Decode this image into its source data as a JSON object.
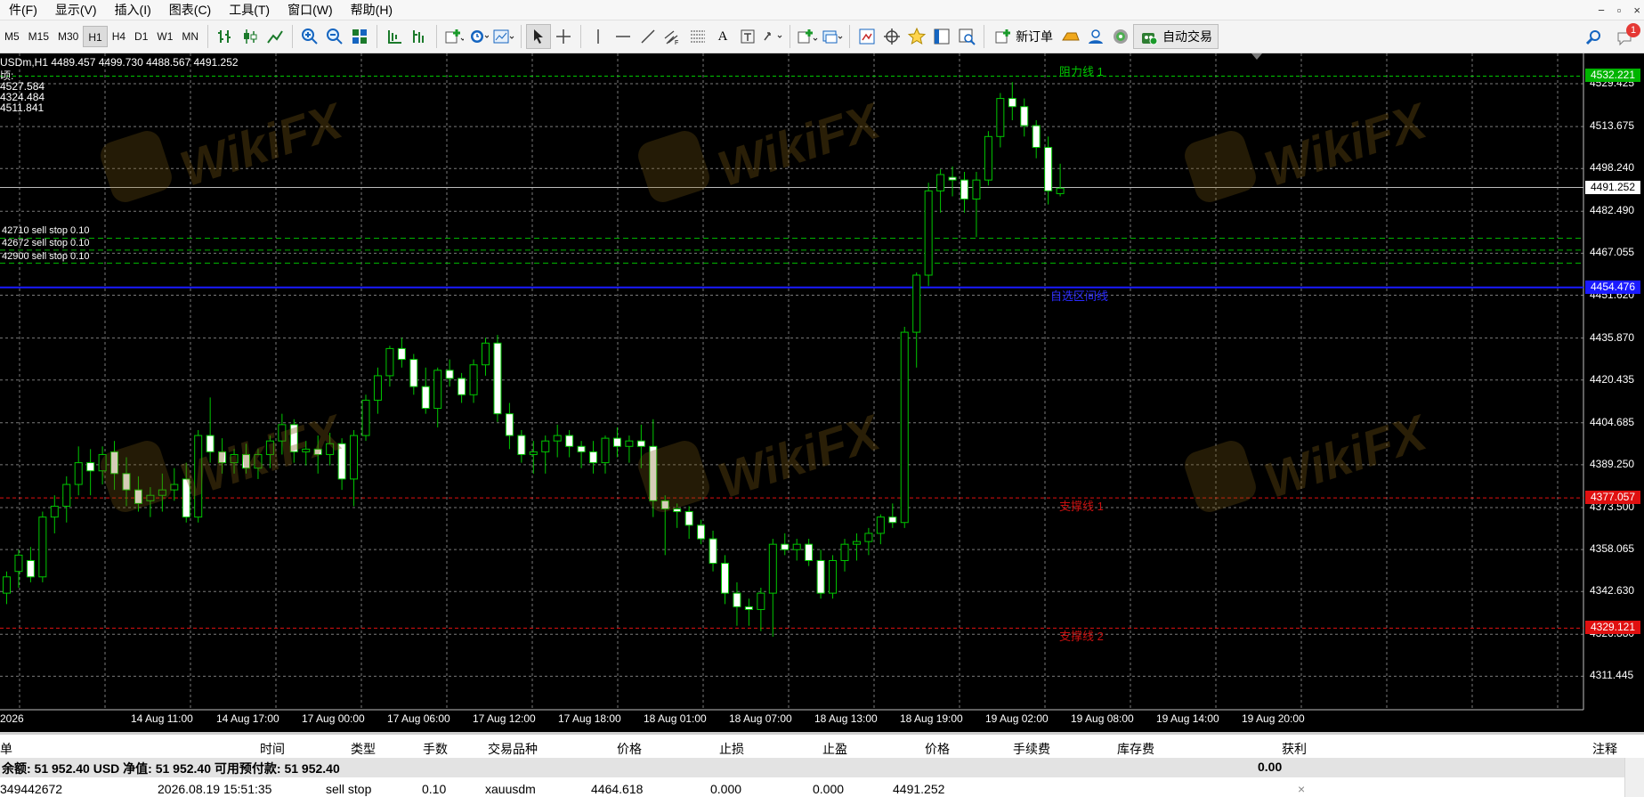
{
  "menu": [
    "件(F)",
    "显示(V)",
    "插入(I)",
    "图表(C)",
    "工具(T)",
    "窗口(W)",
    "帮助(H)"
  ],
  "window_controls": [
    "−",
    "▫",
    "×"
  ],
  "toolbar": {
    "timeframes": [
      "M5",
      "M15",
      "M30",
      "H1",
      "H4",
      "D1",
      "W1",
      "MN"
    ],
    "active_timeframe": "H1",
    "new_order_label": "新订单",
    "auto_trade_label": "自动交易",
    "notification_count": "1"
  },
  "chart": {
    "symbol_line": "USDm,H1  4489.457 4499.730 4488.567 4491.252",
    "info_lines": [
      "顷:",
      "4527.584",
      "4324.484",
      "4511.841"
    ],
    "orders": [
      {
        "label": "42710 sell stop 0.10",
        "price": 4472.6
      },
      {
        "label": "42672 sell stop 0.10",
        "price": 4468.2
      },
      {
        "label": "42900 sell stop 0.10",
        "price": 4463.4
      }
    ],
    "lines": {
      "resistance": {
        "label": "阻力线 1",
        "price": 4532.221,
        "price_tag": "4532.221",
        "color": "#00c800"
      },
      "blue": {
        "label": "自选区间线",
        "price": 4454.476,
        "price_tag": "4454.476",
        "color": "#1a1aff"
      },
      "support1": {
        "label": "支撑线 1",
        "price": 4377.057,
        "price_tag": "4377.057",
        "color": "#e01010"
      },
      "support2": {
        "label": "支撑线 2",
        "price": 4329.121,
        "price_tag": "4329.121",
        "color": "#e01010"
      },
      "current": {
        "price": 4491.252,
        "price_tag": "4491.252"
      }
    },
    "price_ticks": [
      "4529.425",
      "4513.675",
      "4498.240",
      "4482.490",
      "4467.055",
      "4451.620",
      "4435.870",
      "4420.435",
      "4404.685",
      "4389.250",
      "4373.500",
      "4358.065",
      "4342.630",
      "4326.880",
      "4311.445"
    ],
    "time_ticks": [
      "2026",
      "14 Aug 11:00",
      "14 Aug 17:00",
      "17 Aug 00:00",
      "17 Aug 06:00",
      "17 Aug 12:00",
      "17 Aug 18:00",
      "18 Aug 01:00",
      "18 Aug 07:00",
      "18 Aug 13:00",
      "18 Aug 19:00",
      "19 Aug 02:00",
      "19 Aug 08:00",
      "19 Aug 14:00",
      "19 Aug 20:00"
    ],
    "watermark_text": "WikiFX",
    "colors": {
      "bull": "#00c800",
      "bear_fill": "#ffffff",
      "grid": "#7a7a7a",
      "background": "#000000"
    }
  },
  "chart_data": {
    "type": "candlestick",
    "title": "USDm,H1",
    "ylim": [
      4306,
      4535
    ],
    "x": [
      "2026",
      "14 Aug 11:00",
      "14 Aug 17:00",
      "17 Aug 00:00",
      "17 Aug 06:00",
      "17 Aug 12:00",
      "17 Aug 18:00",
      "18 Aug 01:00",
      "18 Aug 07:00",
      "18 Aug 13:00",
      "18 Aug 19:00",
      "19 Aug 02:00",
      "19 Aug 08:00",
      "19 Aug 14:00",
      "19 Aug 20:00"
    ],
    "candles": [
      [
        4342,
        4350,
        4338,
        4348
      ],
      [
        4350,
        4358,
        4344,
        4356
      ],
      [
        4354,
        4359,
        4346,
        4348
      ],
      [
        4348,
        4372,
        4346,
        4370
      ],
      [
        4370,
        4378,
        4364,
        4374
      ],
      [
        4374,
        4385,
        4368,
        4382
      ],
      [
        4382,
        4396,
        4378,
        4390
      ],
      [
        4390,
        4395,
        4378,
        4387
      ],
      [
        4387,
        4396,
        4382,
        4393
      ],
      [
        4394,
        4398,
        4380,
        4386
      ],
      [
        4386,
        4392,
        4374,
        4380
      ],
      [
        4380,
        4385,
        4372,
        4375
      ],
      [
        4376,
        4381,
        4370,
        4378
      ],
      [
        4378,
        4386,
        4372,
        4380
      ],
      [
        4380,
        4388,
        4376,
        4382
      ],
      [
        4384,
        4390,
        4368,
        4370
      ],
      [
        4370,
        4402,
        4368,
        4400
      ],
      [
        4400,
        4414,
        4390,
        4394
      ],
      [
        4394,
        4399,
        4386,
        4390
      ],
      [
        4390,
        4395,
        4386,
        4393
      ],
      [
        4393,
        4397,
        4386,
        4388
      ],
      [
        4388,
        4395,
        4384,
        4393
      ],
      [
        4393,
        4400,
        4388,
        4398
      ],
      [
        4398,
        4408,
        4393,
        4404
      ],
      [
        4404,
        4406,
        4390,
        4394
      ],
      [
        4394,
        4398,
        4389,
        4395
      ],
      [
        4395,
        4400,
        4386,
        4393
      ],
      [
        4393,
        4401,
        4389,
        4397
      ],
      [
        4397,
        4399,
        4380,
        4384
      ],
      [
        4384,
        4402,
        4374,
        4400
      ],
      [
        4400,
        4415,
        4398,
        4413
      ],
      [
        4413,
        4425,
        4408,
        4422
      ],
      [
        4422,
        4433,
        4418,
        4432
      ],
      [
        4432,
        4436,
        4425,
        4428
      ],
      [
        4428,
        4430,
        4415,
        4418
      ],
      [
        4418,
        4425,
        4408,
        4410
      ],
      [
        4410,
        4425,
        4403,
        4424
      ],
      [
        4424,
        4428,
        4418,
        4421
      ],
      [
        4421,
        4423,
        4412,
        4415
      ],
      [
        4415,
        4428,
        4412,
        4426
      ],
      [
        4426,
        4436,
        4422,
        4434
      ],
      [
        4434,
        4437,
        4405,
        4408
      ],
      [
        4408,
        4412,
        4395,
        4400
      ],
      [
        4400,
        4402,
        4390,
        4393
      ],
      [
        4393,
        4398,
        4386,
        4394
      ],
      [
        4394,
        4400,
        4386,
        4398
      ],
      [
        4398,
        4404,
        4392,
        4400
      ],
      [
        4400,
        4402,
        4392,
        4396
      ],
      [
        4396,
        4398,
        4388,
        4394
      ],
      [
        4394,
        4398,
        4386,
        4390
      ],
      [
        4390,
        4400,
        4386,
        4399
      ],
      [
        4399,
        4403,
        4392,
        4396
      ],
      [
        4396,
        4400,
        4390,
        4398
      ],
      [
        4398,
        4404,
        4388,
        4396
      ],
      [
        4396,
        4406,
        4370,
        4376
      ],
      [
        4376,
        4378,
        4356,
        4373
      ],
      [
        4373,
        4375,
        4366,
        4372
      ],
      [
        4372,
        4374,
        4362,
        4367
      ],
      [
        4367,
        4369,
        4360,
        4362
      ],
      [
        4362,
        4365,
        4350,
        4353
      ],
      [
        4353,
        4356,
        4338,
        4342
      ],
      [
        4342,
        4346,
        4330,
        4337
      ],
      [
        4337,
        4340,
        4330,
        4336
      ],
      [
        4336,
        4344,
        4328,
        4342
      ],
      [
        4342,
        4362,
        4326,
        4360
      ],
      [
        4360,
        4364,
        4356,
        4358
      ],
      [
        4358,
        4362,
        4354,
        4360
      ],
      [
        4360,
        4362,
        4352,
        4354
      ],
      [
        4354,
        4358,
        4340,
        4342
      ],
      [
        4342,
        4356,
        4340,
        4354
      ],
      [
        4354,
        4362,
        4350,
        4360
      ],
      [
        4360,
        4364,
        4354,
        4361
      ],
      [
        4361,
        4366,
        4356,
        4364
      ],
      [
        4364,
        4371,
        4360,
        4370
      ],
      [
        4370,
        4375,
        4366,
        4368
      ],
      [
        4368,
        4440,
        4366,
        4438
      ],
      [
        4438,
        4460,
        4425,
        4459
      ],
      [
        4459,
        4493,
        4455,
        4490
      ],
      [
        4490,
        4498,
        4482,
        4496
      ],
      [
        4495,
        4499,
        4488,
        4494
      ],
      [
        4494,
        4497,
        4482,
        4487
      ],
      [
        4487,
        4497,
        4473,
        4494
      ],
      [
        4494,
        4512,
        4492,
        4510
      ],
      [
        4510,
        4526,
        4506,
        4524
      ],
      [
        4524,
        4530,
        4516,
        4521
      ],
      [
        4521,
        4524,
        4510,
        4514
      ],
      [
        4514,
        4516,
        4502,
        4506
      ],
      [
        4506,
        4510,
        4485,
        4490
      ],
      [
        4489,
        4500,
        4488,
        4491
      ]
    ]
  },
  "terminal": {
    "headers": [
      "单",
      "时间",
      "类型",
      "手数",
      "交易品种",
      "价格",
      "止损",
      "止盈",
      "价格",
      "手续费",
      "库存费",
      "获利",
      "注释"
    ],
    "balance_text": "余额: 51 952.40 USD  净值: 51 952.40  可用预付款: 51 952.40",
    "balance_profit": "0.00",
    "row": [
      "349442672",
      "2026.08.19 15:51:35",
      "sell stop",
      "0.10",
      "xauusdm",
      "4464.618",
      "0.000",
      "0.000",
      "4491.252"
    ],
    "row_close": "×"
  }
}
